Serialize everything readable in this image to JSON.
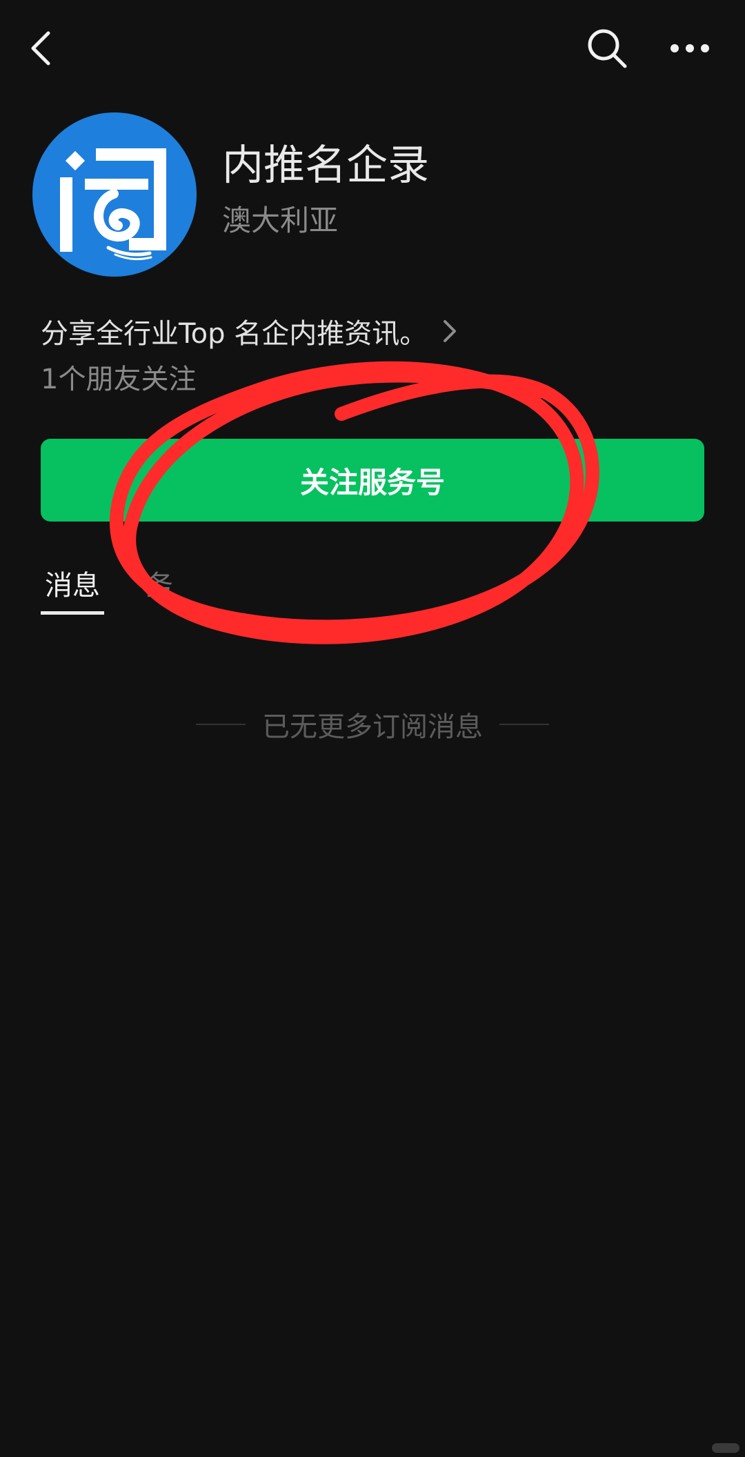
{
  "header": {
    "back_icon": "chevron-left-icon",
    "search_icon": "search-icon",
    "more_icon": "more-horizontal-icon"
  },
  "account": {
    "avatar_icon": "account-logo-icon",
    "name": "内推名企录",
    "region": "澳大利亚",
    "intro": "分享全行业Top 名企内推资讯。",
    "friends": "1个朋友关注"
  },
  "actions": {
    "follow_label": "关注服务号",
    "accent": "#07c160"
  },
  "tabs": [
    {
      "label": "消息",
      "active": true
    },
    {
      "label": "务",
      "active": false
    }
  ],
  "feed": {
    "end_text": "已无更多订阅消息"
  },
  "annotation": {
    "color": "#ff2b2b"
  }
}
